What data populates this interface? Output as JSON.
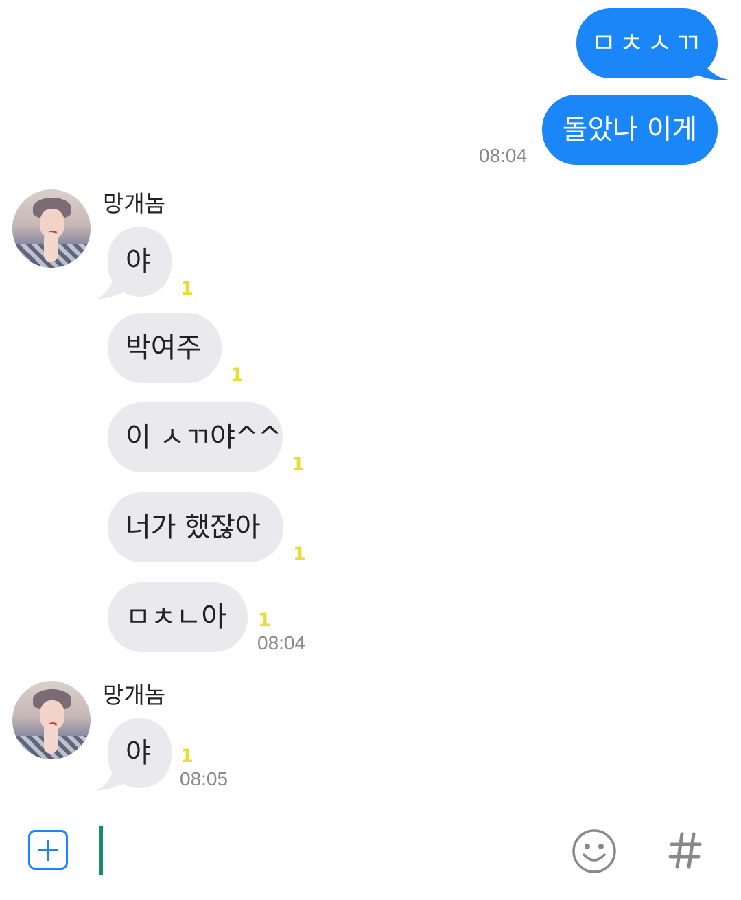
{
  "outgoing": [
    {
      "text": "ㅁㅊㅅㄲ"
    },
    {
      "text": "돌았나 이게",
      "time": "08:04"
    }
  ],
  "groups": [
    {
      "sender": "망개놈",
      "messages": [
        {
          "text": "야",
          "unread": "1"
        },
        {
          "text": "박여주",
          "unread": "1"
        },
        {
          "text": "이 ㅅㄲ야^^",
          "unread": "1"
        },
        {
          "text": "너가 했잖아",
          "unread": "1"
        },
        {
          "text": "ㅁㅊㄴ아",
          "unread": "1",
          "time": "08:04"
        }
      ]
    },
    {
      "sender": "망개놈",
      "messages": [
        {
          "text": "야",
          "unread": "1",
          "time": "08:05"
        }
      ]
    }
  ],
  "input": {
    "value": "",
    "placeholder": ""
  },
  "icons": {
    "attach": "plus-icon",
    "emoji": "smiley-icon",
    "hashtag": "hash-icon"
  },
  "colors": {
    "outgoing_bubble": "#1a86f7",
    "incoming_bubble": "#e9e9ee",
    "unread": "#e8dc3a",
    "caret": "#1a8a6e"
  }
}
